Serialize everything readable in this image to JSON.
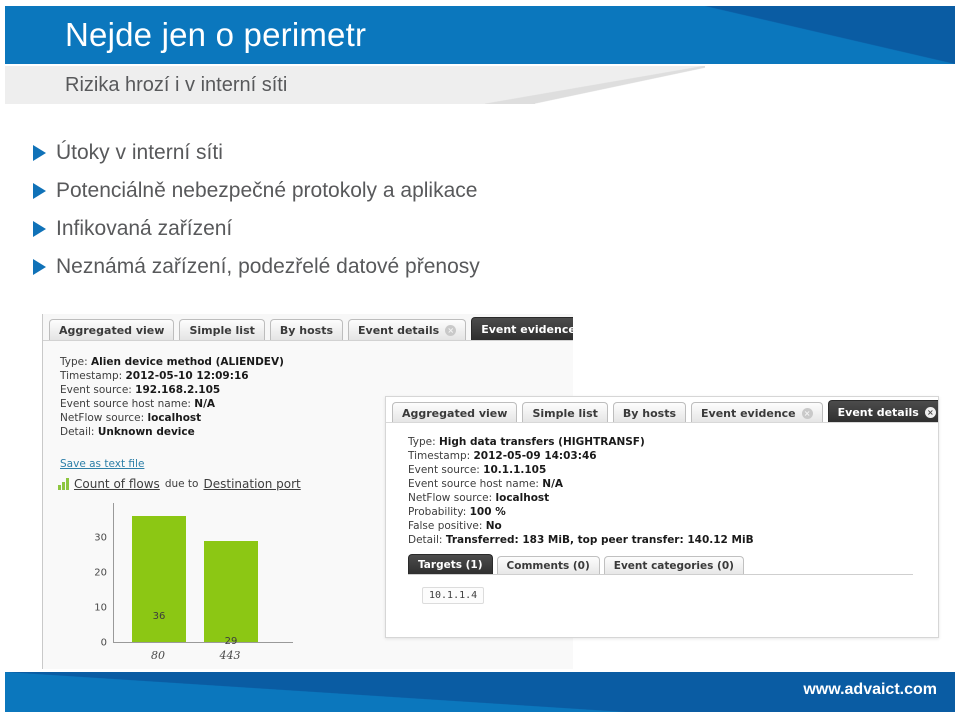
{
  "slide": {
    "title": "Nejde jen o perimetr",
    "subtitle": "Rizika hrozí i v interní síti",
    "footer_url": "www.advaict.com",
    "accent_blue": "#0b77bd",
    "accent_blue_dark": "#0a5ca3",
    "bullet_color": "#1072b8",
    "bar_green": "#8cc714"
  },
  "bullets": [
    {
      "label": "Útoky v interní síti"
    },
    {
      "label": "Potenciálně nebezpečné protokoly a aplikace"
    },
    {
      "label": "Infikovaná zařízení"
    },
    {
      "label": "Neznámá zařízení, podezřelé datové přenosy"
    }
  ],
  "panel_a": {
    "tabs": [
      {
        "label": "Aggregated view",
        "active": false,
        "closable": false
      },
      {
        "label": "Simple list",
        "active": false,
        "closable": false
      },
      {
        "label": "By hosts",
        "active": false,
        "closable": false
      },
      {
        "label": "Event details",
        "active": false,
        "closable": true
      },
      {
        "label": "Event evidence",
        "active": true,
        "closable": true
      }
    ],
    "close_glyph": "×",
    "details": [
      {
        "key": "Type:",
        "value": "Alien device method (ALIENDEV)"
      },
      {
        "key": "Timestamp:",
        "value": "2012-05-10 12:09:16"
      },
      {
        "key": "Event source:",
        "value": "192.168.2.105"
      },
      {
        "key": "Event source host name:",
        "value": "N/A"
      },
      {
        "key": "NetFlow source:",
        "value": "localhost"
      },
      {
        "key": "Detail:",
        "value": "Unknown device"
      }
    ],
    "save_link": "Save as text file",
    "chart_caption": {
      "metric": "Count of flows",
      "connector": "due to",
      "dimension": "Destination port",
      "icon": "bar-chart-icon"
    }
  },
  "panel_b": {
    "tabs": [
      {
        "label": "Aggregated view",
        "active": false,
        "closable": false
      },
      {
        "label": "Simple list",
        "active": false,
        "closable": false
      },
      {
        "label": "By hosts",
        "active": false,
        "closable": false
      },
      {
        "label": "Event evidence",
        "active": false,
        "closable": true
      },
      {
        "label": "Event details",
        "active": true,
        "closable": true
      }
    ],
    "close_glyph": "×",
    "details": [
      {
        "key": "Type:",
        "value": "High data transfers (HIGHTRANSF)"
      },
      {
        "key": "Timestamp:",
        "value": "2012-05-09 14:03:46"
      },
      {
        "key": "Event source:",
        "value": "10.1.1.105"
      },
      {
        "key": "Event source host name:",
        "value": "N/A"
      },
      {
        "key": "NetFlow source:",
        "value": "localhost"
      },
      {
        "key": "Probability:",
        "value": "100 %"
      },
      {
        "key": "False positive:",
        "value": "No"
      },
      {
        "key": "Detail:",
        "value": "Transferred: 183 MiB, top peer transfer: 140.12 MiB"
      }
    ],
    "subtabs": [
      {
        "label": "Targets (1)",
        "active": true
      },
      {
        "label": "Comments (0)",
        "active": false
      },
      {
        "label": "Event categories (0)",
        "active": false
      }
    ],
    "target_value": "10.1.1.4"
  },
  "chart_data": {
    "type": "bar",
    "title": "Count of flows due to Destination port",
    "xlabel": "Destination port",
    "ylabel": "Count of flows",
    "categories": [
      "80",
      "443"
    ],
    "values": [
      36,
      29
    ],
    "data_labels": [
      "36",
      "29"
    ],
    "yticks": [
      0,
      10,
      20,
      30
    ],
    "ylim": [
      0,
      40
    ],
    "grid": false,
    "legend": false,
    "series_color": "#8cc714"
  }
}
